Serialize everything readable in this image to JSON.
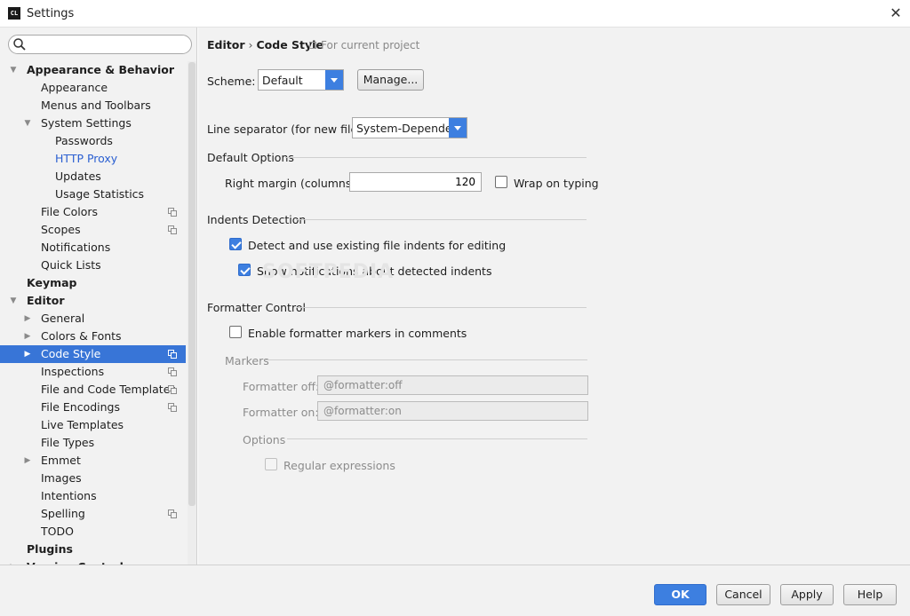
{
  "window": {
    "title": "Settings",
    "app_icon": "CL",
    "close": "✕"
  },
  "sidebar": {
    "search": {
      "placeholder": "",
      "value": ""
    },
    "items": [
      {
        "label": "Appearance & Behavior",
        "level": 0,
        "bold": true,
        "arrow": "▼"
      },
      {
        "label": "Appearance",
        "level": 1
      },
      {
        "label": "Menus and Toolbars",
        "level": 1
      },
      {
        "label": "System Settings",
        "level": 1,
        "arrow": "▼"
      },
      {
        "label": "Passwords",
        "level": 2
      },
      {
        "label": "HTTP Proxy",
        "level": 2,
        "link": true
      },
      {
        "label": "Updates",
        "level": 2
      },
      {
        "label": "Usage Statistics",
        "level": 2
      },
      {
        "label": "File Colors",
        "level": 1,
        "project": true
      },
      {
        "label": "Scopes",
        "level": 1,
        "project": true
      },
      {
        "label": "Notifications",
        "level": 1
      },
      {
        "label": "Quick Lists",
        "level": 1
      },
      {
        "label": "Keymap",
        "level": 0,
        "bold": true
      },
      {
        "label": "Editor",
        "level": 0,
        "bold": true,
        "arrow": "▼"
      },
      {
        "label": "General",
        "level": 1,
        "arrow": "▶"
      },
      {
        "label": "Colors & Fonts",
        "level": 1,
        "arrow": "▶"
      },
      {
        "label": "Code Style",
        "level": 1,
        "arrow": "▶",
        "selected": true,
        "project": true
      },
      {
        "label": "Inspections",
        "level": 1,
        "project": true
      },
      {
        "label": "File and Code Templates",
        "level": 1,
        "project": true
      },
      {
        "label": "File Encodings",
        "level": 1,
        "project": true
      },
      {
        "label": "Live Templates",
        "level": 1
      },
      {
        "label": "File Types",
        "level": 1
      },
      {
        "label": "Emmet",
        "level": 1,
        "arrow": "▶"
      },
      {
        "label": "Images",
        "level": 1
      },
      {
        "label": "Intentions",
        "level": 1
      },
      {
        "label": "Spelling",
        "level": 1,
        "project": true
      },
      {
        "label": "TODO",
        "level": 1
      },
      {
        "label": "Plugins",
        "level": 0,
        "bold": true
      },
      {
        "label": "Version Control",
        "level": 0,
        "bold": true,
        "arrow": "▶"
      }
    ]
  },
  "main": {
    "breadcrumb": {
      "parent": "Editor",
      "separator": "›",
      "current": "Code Style"
    },
    "for_current_project": "For current project",
    "scheme": {
      "label": "Scheme:",
      "value": "Default",
      "manage_label": "Manage..."
    },
    "line_separator": {
      "label": "Line separator (for new files):",
      "value": "System-Dependent"
    },
    "default_options": {
      "title": "Default Options",
      "right_margin_label": "Right margin (columns):",
      "right_margin_value": "120",
      "wrap_on_typing": {
        "label": "Wrap on typing",
        "checked": false
      }
    },
    "indents_detection": {
      "title": "Indents Detection",
      "detect": {
        "label": "Detect and use existing file indents for editing",
        "checked": true
      },
      "notify": {
        "label": "Show notifications about detected indents",
        "checked": true
      }
    },
    "formatter_control": {
      "title": "Formatter Control",
      "enable": {
        "label": "Enable formatter markers in comments",
        "checked": false
      },
      "markers_title": "Markers",
      "off_label": "Formatter off:",
      "off_value": "@formatter:off",
      "on_label": "Formatter on:",
      "on_value": "@formatter:on",
      "options_title": "Options",
      "regex": {
        "label": "Regular expressions",
        "checked": false
      }
    },
    "watermark": "SOFTPEDIA"
  },
  "footer": {
    "ok": "OK",
    "cancel": "Cancel",
    "apply": "Apply",
    "help": "Help"
  },
  "colors": {
    "accent": "#3d7fe0",
    "selection": "#3875d7",
    "link": "#2a5fd1",
    "panel": "#f2f2f2"
  }
}
